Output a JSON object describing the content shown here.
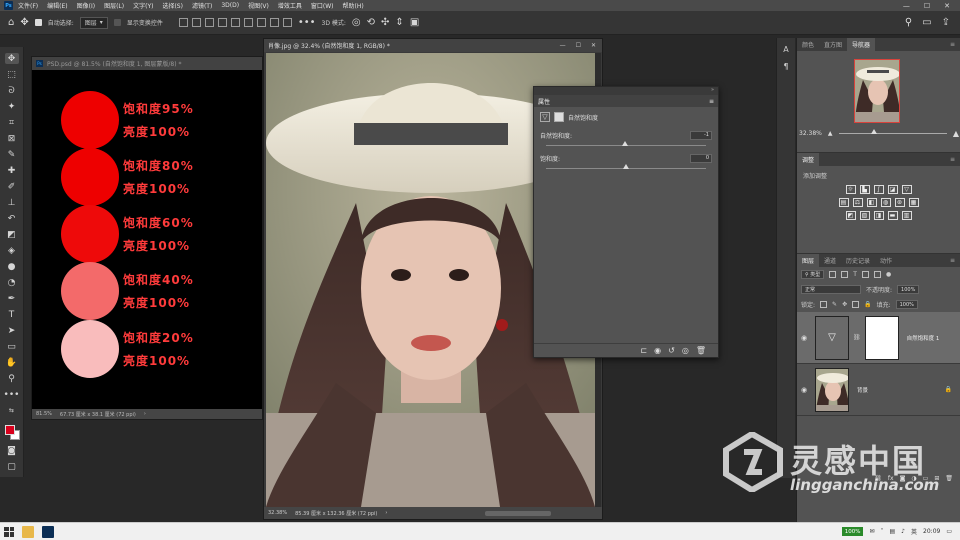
{
  "menubar": {
    "items": [
      "文件(F)",
      "编辑(E)",
      "图像(I)",
      "图层(L)",
      "文字(Y)",
      "选择(S)",
      "滤镜(T)",
      "3D(D)",
      "视图(V)",
      "增效工具",
      "窗口(W)",
      "帮助(H)"
    ]
  },
  "options": {
    "auto_select_label": "自动选择:",
    "auto_select_value": "图层",
    "show_transform_label": "显示变换控件",
    "mode3d_label": "3D 模式:"
  },
  "colors": {
    "foreground": "#d8001c",
    "accent_red": "#ff3b3b"
  },
  "doc1": {
    "title": "PSD.psd @ 81.5% (自然饱和度 1, 图层蒙版/8) *",
    "zoom": "81.5%",
    "size": "67.73 厘米 x 38.1 厘米 (72 ppi)",
    "swatches": [
      {
        "color": "#ee0000",
        "saturation": "饱和度95%",
        "brightness": "亮度100%"
      },
      {
        "color": "#ee0000",
        "saturation": "饱和度80%",
        "brightness": "亮度100%"
      },
      {
        "color": "#ee0a0a",
        "saturation": "饱和度60%",
        "brightness": "亮度100%"
      },
      {
        "color": "#f36a6a",
        "saturation": "饱和度40%",
        "brightness": "亮度100%"
      },
      {
        "color": "#f9bcbc",
        "saturation": "饱和度20%",
        "brightness": "亮度100%"
      }
    ]
  },
  "doc2": {
    "title": "肖像.jpg @ 32.4% (自然饱和度 1, RGB/8) *",
    "zoom": "32.38%",
    "size": "85.39 厘米 x 132.36 厘米 (72 ppi)"
  },
  "properties": {
    "panel_title": "属性",
    "type_label": "自然饱和度",
    "vibrance_label": "自然饱和度:",
    "vibrance_value": "-1",
    "vibrance_level": 0.495,
    "saturation_label": "饱和度:",
    "saturation_value": "0",
    "saturation_level": 0.5
  },
  "navigator": {
    "tabs": [
      "颜色",
      "直方图",
      "导航器"
    ],
    "zoom": "32.38%",
    "zoom_level": 0.33
  },
  "adjustments": {
    "title": "调整",
    "add_label": "添加调整"
  },
  "layers": {
    "tabs": [
      "图层",
      "通道",
      "历史记录",
      "动作"
    ],
    "filter_value": "类型",
    "blend_mode": "正常",
    "opacity_label": "不透明度:",
    "opacity_value": "100%",
    "lock_label": "锁定:",
    "fill_label": "填充:",
    "fill_value": "100%",
    "items": [
      {
        "name": "自然饱和度 1",
        "selected": true
      },
      {
        "name": "背景",
        "selected": false
      }
    ],
    "footer": [
      "fx"
    ]
  },
  "watermark": {
    "title": "灵感中国",
    "url": "lingganchina.com"
  },
  "taskbar": {
    "battery": "100%",
    "ime": "英",
    "time": "20:09"
  }
}
